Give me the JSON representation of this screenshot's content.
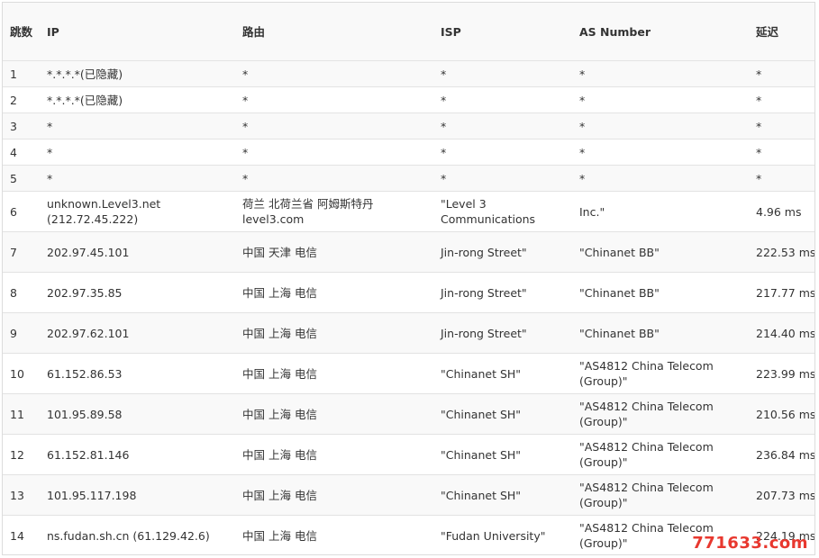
{
  "table": {
    "headers": [
      "跳数",
      "IP",
      "路由",
      "ISP",
      "AS Number",
      "延迟"
    ],
    "rows": [
      {
        "hop": "1",
        "ip": "*.*.*.*(已隐藏)",
        "route": "*",
        "isp": "*",
        "as": "*",
        "latency": "*"
      },
      {
        "hop": "2",
        "ip": "*.*.*.*(已隐藏)",
        "route": "*",
        "isp": "*",
        "as": "*",
        "latency": "*"
      },
      {
        "hop": "3",
        "ip": "*",
        "route": "*",
        "isp": "*",
        "as": "*",
        "latency": "*"
      },
      {
        "hop": "4",
        "ip": "*",
        "route": "*",
        "isp": "*",
        "as": "*",
        "latency": "*"
      },
      {
        "hop": "5",
        "ip": "*",
        "route": "*",
        "isp": "*",
        "as": "*",
        "latency": "*"
      },
      {
        "hop": "6",
        "ip": "unknown.Level3.net (212.72.45.222)",
        "route": "荷兰 北荷兰省 阿姆斯特丹 level3.com",
        "isp": "\"Level 3 Communications",
        "as": "Inc.\"",
        "latency": "4.96 ms"
      },
      {
        "hop": "7",
        "ip": "202.97.45.101",
        "route": "中国 天津 电信",
        "isp": "Jin-rong Street\"",
        "as": "\"Chinanet BB\"",
        "latency": "222.53 ms"
      },
      {
        "hop": "8",
        "ip": "202.97.35.85",
        "route": "中国 上海 电信",
        "isp": "Jin-rong Street\"",
        "as": "\"Chinanet BB\"",
        "latency": "217.77 ms"
      },
      {
        "hop": "9",
        "ip": "202.97.62.101",
        "route": "中国 上海 电信",
        "isp": "Jin-rong Street\"",
        "as": "\"Chinanet BB\"",
        "latency": "214.40 ms"
      },
      {
        "hop": "10",
        "ip": "61.152.86.53",
        "route": "中国 上海 电信",
        "isp": "\"Chinanet SH\"",
        "as": "\"AS4812 China Telecom (Group)\"",
        "latency": "223.99 ms"
      },
      {
        "hop": "11",
        "ip": "101.95.89.58",
        "route": "中国 上海 电信",
        "isp": "\"Chinanet SH\"",
        "as": "\"AS4812 China Telecom (Group)\"",
        "latency": "210.56 ms"
      },
      {
        "hop": "12",
        "ip": "61.152.81.146",
        "route": "中国 上海 电信",
        "isp": "\"Chinanet SH\"",
        "as": "\"AS4812 China Telecom (Group)\"",
        "latency": "236.84 ms"
      },
      {
        "hop": "13",
        "ip": "101.95.117.198",
        "route": "中国 上海 电信",
        "isp": "\"Chinanet SH\"",
        "as": "\"AS4812 China Telecom (Group)\"",
        "latency": "207.73 ms"
      },
      {
        "hop": "14",
        "ip": "ns.fudan.sh.cn (61.129.42.6)",
        "route": "中国 上海 电信",
        "isp": "\"Fudan University\"",
        "as": "\"AS4812 China Telecom (Group)\"",
        "latency": "224.19 ms"
      }
    ]
  },
  "watermark": "771633.com"
}
